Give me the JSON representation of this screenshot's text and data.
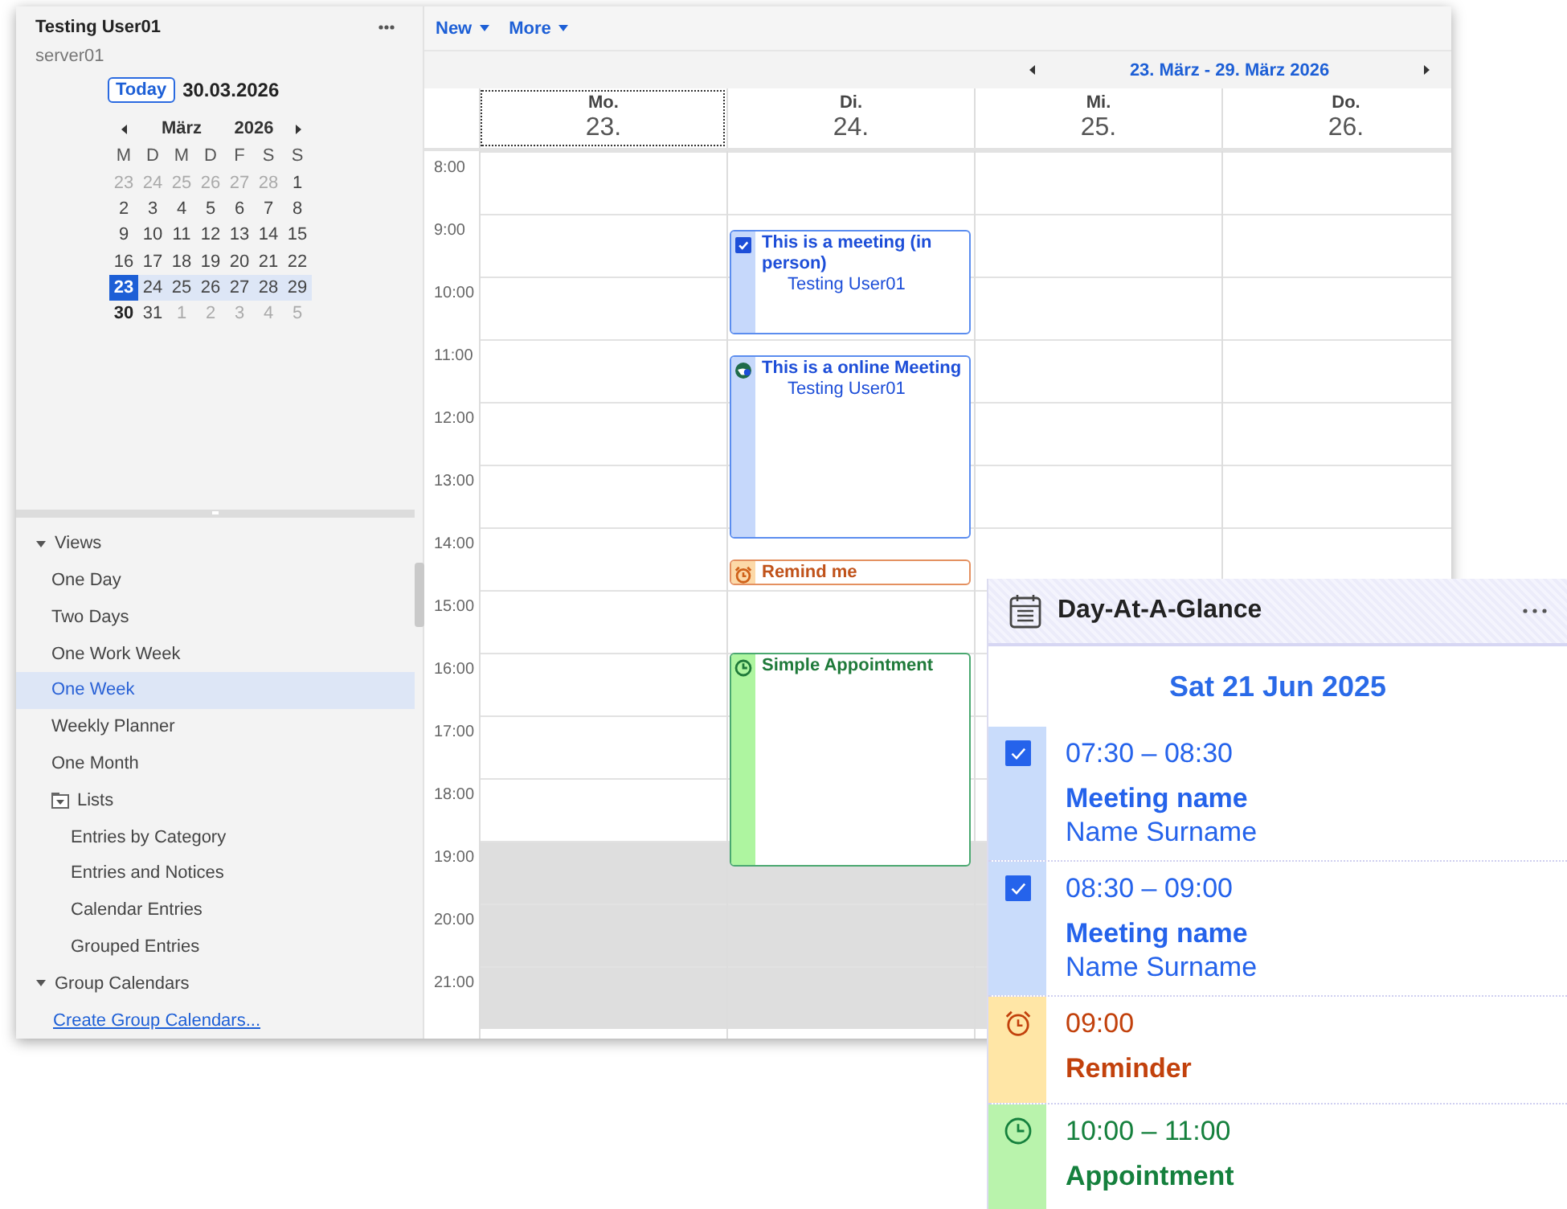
{
  "sidebar": {
    "user": "Testing User01",
    "server": "server01",
    "today_button": "Today",
    "current_date": "30.03.2026",
    "mini_calendar": {
      "month": "März",
      "year": "2026",
      "weekdays": [
        "M",
        "D",
        "M",
        "D",
        "F",
        "S",
        "S"
      ],
      "weeks": [
        {
          "selected": false,
          "days": [
            {
              "label": "23",
              "muted": true,
              "selected": false,
              "today": false
            },
            {
              "label": "24",
              "muted": true,
              "selected": false,
              "today": false
            },
            {
              "label": "25",
              "muted": true,
              "selected": false,
              "today": false
            },
            {
              "label": "26",
              "muted": true,
              "selected": false,
              "today": false
            },
            {
              "label": "27",
              "muted": true,
              "selected": false,
              "today": false
            },
            {
              "label": "28",
              "muted": true,
              "selected": false,
              "today": false
            },
            {
              "label": "1",
              "muted": false,
              "selected": false,
              "today": false
            }
          ]
        },
        {
          "selected": false,
          "days": [
            {
              "label": "2",
              "muted": false,
              "selected": false,
              "today": false
            },
            {
              "label": "3",
              "muted": false,
              "selected": false,
              "today": false
            },
            {
              "label": "4",
              "muted": false,
              "selected": false,
              "today": false
            },
            {
              "label": "5",
              "muted": false,
              "selected": false,
              "today": false
            },
            {
              "label": "6",
              "muted": false,
              "selected": false,
              "today": false
            },
            {
              "label": "7",
              "muted": false,
              "selected": false,
              "today": false
            },
            {
              "label": "8",
              "muted": false,
              "selected": false,
              "today": false
            }
          ]
        },
        {
          "selected": false,
          "days": [
            {
              "label": "9",
              "muted": false,
              "selected": false,
              "today": false
            },
            {
              "label": "10",
              "muted": false,
              "selected": false,
              "today": false
            },
            {
              "label": "11",
              "muted": false,
              "selected": false,
              "today": false
            },
            {
              "label": "12",
              "muted": false,
              "selected": false,
              "today": false
            },
            {
              "label": "13",
              "muted": false,
              "selected": false,
              "today": false
            },
            {
              "label": "14",
              "muted": false,
              "selected": false,
              "today": false
            },
            {
              "label": "15",
              "muted": false,
              "selected": false,
              "today": false
            }
          ]
        },
        {
          "selected": false,
          "days": [
            {
              "label": "16",
              "muted": false,
              "selected": false,
              "today": false
            },
            {
              "label": "17",
              "muted": false,
              "selected": false,
              "today": false
            },
            {
              "label": "18",
              "muted": false,
              "selected": false,
              "today": false
            },
            {
              "label": "19",
              "muted": false,
              "selected": false,
              "today": false
            },
            {
              "label": "20",
              "muted": false,
              "selected": false,
              "today": false
            },
            {
              "label": "21",
              "muted": false,
              "selected": false,
              "today": false
            },
            {
              "label": "22",
              "muted": false,
              "selected": false,
              "today": false
            }
          ]
        },
        {
          "selected": true,
          "days": [
            {
              "label": "23",
              "muted": false,
              "selected": true,
              "today": false
            },
            {
              "label": "24",
              "muted": false,
              "selected": false,
              "today": false
            },
            {
              "label": "25",
              "muted": false,
              "selected": false,
              "today": false
            },
            {
              "label": "26",
              "muted": false,
              "selected": false,
              "today": false
            },
            {
              "label": "27",
              "muted": false,
              "selected": false,
              "today": false
            },
            {
              "label": "28",
              "muted": false,
              "selected": false,
              "today": false
            },
            {
              "label": "29",
              "muted": false,
              "selected": false,
              "today": false
            }
          ]
        },
        {
          "selected": false,
          "days": [
            {
              "label": "30",
              "muted": false,
              "selected": false,
              "today": true
            },
            {
              "label": "31",
              "muted": false,
              "selected": false,
              "today": false
            },
            {
              "label": "1",
              "muted": true,
              "selected": false,
              "today": false
            },
            {
              "label": "2",
              "muted": true,
              "selected": false,
              "today": false
            },
            {
              "label": "3",
              "muted": true,
              "selected": false,
              "today": false
            },
            {
              "label": "4",
              "muted": true,
              "selected": false,
              "today": false
            },
            {
              "label": "5",
              "muted": true,
              "selected": false,
              "today": false
            }
          ]
        }
      ]
    },
    "navigation": [
      {
        "label": "Views",
        "kind": "group",
        "expanded": true,
        "selected": false,
        "children": [
          {
            "label": "One Day",
            "kind": "view",
            "selected": false
          },
          {
            "label": "Two Days",
            "kind": "view",
            "selected": false
          },
          {
            "label": "One Work Week",
            "kind": "view",
            "selected": false
          },
          {
            "label": "One Week",
            "kind": "view",
            "selected": true
          },
          {
            "label": "Weekly Planner",
            "kind": "view",
            "selected": false
          },
          {
            "label": "One Month",
            "kind": "view",
            "selected": false
          },
          {
            "label": "Lists",
            "kind": "folder",
            "expanded": true,
            "selected": false,
            "children": [
              {
                "label": "Entries by Category",
                "kind": "view",
                "selected": false
              },
              {
                "label": "Entries and Notices",
                "kind": "view",
                "selected": false
              },
              {
                "label": "Calendar Entries",
                "kind": "view",
                "selected": false
              },
              {
                "label": "Grouped Entries",
                "kind": "view",
                "selected": false
              }
            ]
          }
        ]
      },
      {
        "label": "Group Calendars",
        "kind": "group",
        "expanded": true,
        "selected": false,
        "children": [
          {
            "label": "Create Group Calendars...",
            "kind": "link"
          }
        ]
      }
    ]
  },
  "toolbar": [
    {
      "label": "New"
    },
    {
      "label": "More"
    }
  ],
  "week_nav": {
    "range": "23. März - 29. März 2026"
  },
  "hours": [
    {
      "label": "8:00",
      "off_hours": false
    },
    {
      "label": "9:00",
      "off_hours": false
    },
    {
      "label": "10:00",
      "off_hours": false
    },
    {
      "label": "11:00",
      "off_hours": false
    },
    {
      "label": "12:00",
      "off_hours": false
    },
    {
      "label": "13:00",
      "off_hours": false
    },
    {
      "label": "14:00",
      "off_hours": false
    },
    {
      "label": "15:00",
      "off_hours": false
    },
    {
      "label": "16:00",
      "off_hours": false
    },
    {
      "label": "17:00",
      "off_hours": false
    },
    {
      "label": "18:00",
      "off_hours": false
    },
    {
      "label": "19:00",
      "off_hours": true
    },
    {
      "label": "20:00",
      "off_hours": true
    },
    {
      "label": "21:00",
      "off_hours": true
    }
  ],
  "days": [
    {
      "weekday": "Mo.",
      "date": "23.",
      "selected": true
    },
    {
      "weekday": "Di.",
      "date": "24.",
      "selected": false,
      "events": [
        {
          "kind": "meeting",
          "title": "This is a meeting (in person)",
          "owner": "Testing User01"
        },
        {
          "kind": "online",
          "title": "This is a online Meeting",
          "owner": "Testing User01"
        },
        {
          "kind": "reminder",
          "title": "Remind me"
        },
        {
          "kind": "appointment",
          "title": "Simple Appointment"
        }
      ]
    },
    {
      "weekday": "Mi.",
      "date": "25.",
      "selected": false
    },
    {
      "weekday": "Do.",
      "date": "26.",
      "selected": false
    }
  ],
  "glance": {
    "title": "Day-At-A-Glance",
    "date": "Sat 21 Jun 2025",
    "entries": [
      {
        "kind": "meeting",
        "time": "07:30 – 08:30",
        "title": "Meeting name",
        "person": "Name Surname"
      },
      {
        "kind": "meeting",
        "time": "08:30 – 09:00",
        "title": "Meeting name",
        "person": "Name Surname"
      },
      {
        "kind": "reminder",
        "time": "09:00",
        "title": "Reminder"
      },
      {
        "kind": "appointment",
        "time": "10:00 – 11:00",
        "title": "Appointment"
      }
    ]
  }
}
